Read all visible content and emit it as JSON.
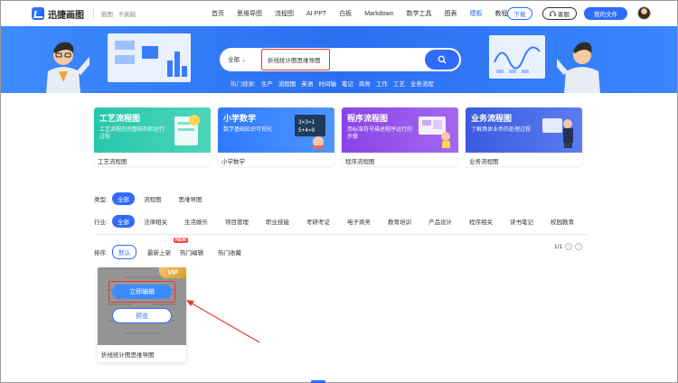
{
  "header": {
    "logo_text": "迅捷画图",
    "slogan": "脑图 · 不挑脑",
    "nav": [
      "首页",
      "思维导图",
      "流程图",
      "AI PPT",
      "白板",
      "Markdown",
      "数学工具",
      "图表",
      "模板",
      "教程"
    ],
    "nav_active_index": 8,
    "download_label": "下载",
    "service_label": "客服",
    "myfiles_label": "我的文件"
  },
  "hero": {
    "scope_label": "全部",
    "search_value": "折线统计图思维导图",
    "hot_label": "热门搜索:",
    "hot_tags": [
      "生产",
      "流程图",
      "英语",
      "时间轴",
      "笔记",
      "商务",
      "工作",
      "工艺",
      "业务流程"
    ]
  },
  "categories": [
    {
      "title": "工艺流程图",
      "desc": "工艺流程的完整结构和运行过程",
      "caption": "工艺流程图"
    },
    {
      "title": "小学数学",
      "desc": "数学基础知识可视化",
      "caption": "小学数学"
    },
    {
      "title": "程序流程图",
      "desc": "用标准符号描述程序运行的步骤",
      "caption": "程序流程图"
    },
    {
      "title": "业务流程图",
      "desc": "了解具体业务的处理过程",
      "caption": "业务流程图"
    }
  ],
  "filters": {
    "type_label": "类型:",
    "type_active": "全部",
    "type_options": [
      "流程图",
      "思维导图"
    ],
    "industry_label": "行业:",
    "industry_active": "全部",
    "industry_options": [
      "法律相关",
      "生活娱乐",
      "项目管理",
      "职业技能",
      "考研考证",
      "电子商务",
      "教育培训",
      "产品设计",
      "程序相关",
      "读书笔记",
      "校园教育"
    ],
    "sort_label": "排序:",
    "sort_active": "默认",
    "sort_options": [
      "最新上架",
      "热门编辑",
      "热门收藏"
    ],
    "new_badge": "NEW"
  },
  "pager": {
    "text": "1/1"
  },
  "template": {
    "vip_label": "VIP",
    "edit_label": "立即编辑",
    "preview_label": "预览",
    "name": "折线统计图思维导图"
  },
  "colors": {
    "accent": "#2f6bff",
    "highlight": "#e53935"
  }
}
